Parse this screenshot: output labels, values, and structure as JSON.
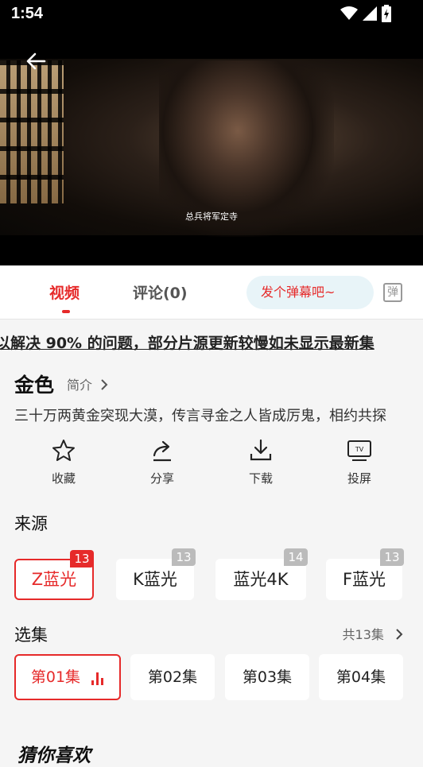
{
  "status_bar": {
    "time": "1:54"
  },
  "video": {
    "subtitle": "总兵将军定寺"
  },
  "tabs": {
    "video": "视频",
    "comments": "评论(0)",
    "danmu_placeholder": "发个弹幕吧~",
    "danmu_toggle": "弹"
  },
  "notice": {
    "text": "以解决 90% 的问题，部分片源更新较慢如未显示最新集"
  },
  "show": {
    "title": "金色",
    "intro_link": "简介",
    "description": "三十万两黄金突现大漠，传言寻金之人皆成厉鬼，相约共探"
  },
  "actions": {
    "favorite": "收藏",
    "share": "分享",
    "download": "下载",
    "cast": "投屏"
  },
  "sources": {
    "title": "来源",
    "items": [
      {
        "label": "Z蓝光",
        "count": "13"
      },
      {
        "label": "K蓝光",
        "count": "13"
      },
      {
        "label": "蓝光4K",
        "count": "14"
      },
      {
        "label": "F蓝光",
        "count": "13"
      }
    ]
  },
  "episodes": {
    "title": "选集",
    "total": "共13集",
    "items": [
      "第01集",
      "第02集",
      "第03集",
      "第04集"
    ]
  },
  "recommend": {
    "title": "猜你喜欢"
  },
  "colors": {
    "accent": "#e62a2a",
    "background": "#f5f5f5"
  }
}
